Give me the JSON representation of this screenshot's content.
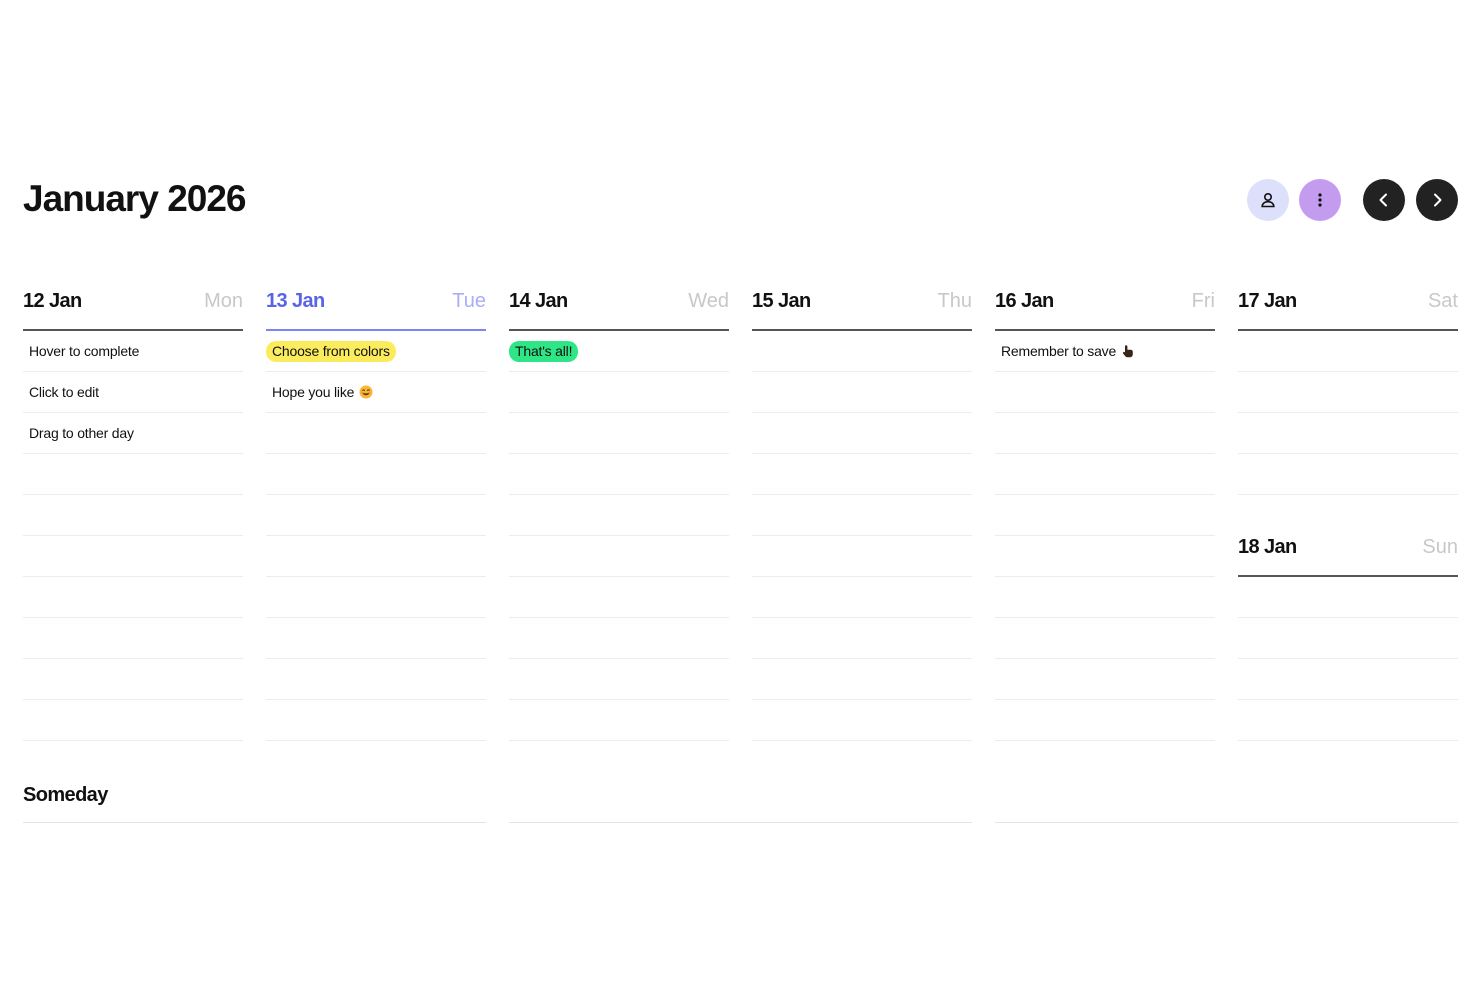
{
  "header": {
    "title": "January 2026"
  },
  "toolbar": {
    "account_icon": "user-icon",
    "menu_icon": "more-vertical-icon",
    "prev_icon": "chevron-left-icon",
    "next_icon": "chevron-right-icon",
    "colors": {
      "account_bg": "#dde0fb",
      "menu_bg": "#c39cf0",
      "nav_bg": "#222222"
    }
  },
  "week": {
    "today_color": "#5a63e6",
    "days": [
      {
        "date": "12 Jan",
        "weekday": "Mon",
        "today": false,
        "tasks": [
          {
            "text": "Hover to complete",
            "color": null
          },
          {
            "text": "Click to edit",
            "color": null
          },
          {
            "text": "Drag to other day",
            "color": null
          }
        ]
      },
      {
        "date": "13 Jan",
        "weekday": "Tue",
        "today": true,
        "tasks": [
          {
            "text": "Choose from colors",
            "color": "#fbec5d"
          },
          {
            "text": "Hope you like",
            "color": null,
            "emoji": "smiling-face-icon"
          }
        ]
      },
      {
        "date": "14 Jan",
        "weekday": "Wed",
        "today": false,
        "tasks": [
          {
            "text": "That's all!",
            "color": "#2ee685"
          }
        ]
      },
      {
        "date": "15 Jan",
        "weekday": "Thu",
        "today": false,
        "tasks": []
      },
      {
        "date": "16 Jan",
        "weekday": "Fri",
        "today": false,
        "tasks": [
          {
            "text": "Remember to save",
            "color": null,
            "emoji": "pointing-hand-icon"
          }
        ]
      },
      {
        "date": "17 Jan",
        "weekday": "Sat",
        "today": false,
        "tasks": []
      },
      {
        "date": "18 Jan",
        "weekday": "Sun",
        "today": false,
        "tasks": []
      }
    ]
  },
  "someday": {
    "title": "Someday"
  }
}
